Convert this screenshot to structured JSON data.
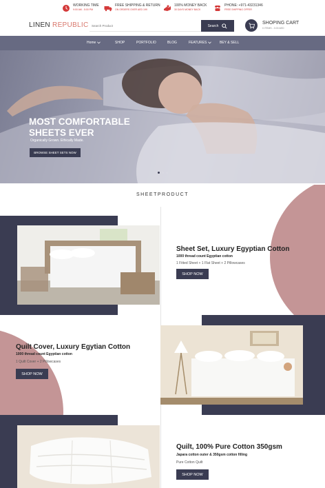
{
  "topbar": {
    "items": [
      {
        "title": "WORKING TIME",
        "sub": "9:00 AM - 5:00 PM",
        "icon": "clock-icon"
      },
      {
        "title": "FREE SHIPPING & RETURN",
        "sub": "ON ORDERS OVER AED 199",
        "icon": "truck-icon"
      },
      {
        "title": "100% MONEY BACK",
        "sub": "30 DAYS MONEY BACK",
        "icon": "money-back-icon"
      },
      {
        "title": "PHONE: +971-43231346",
        "sub": "FREE SHIPPING OFFER",
        "icon": "phone-icon"
      }
    ]
  },
  "header": {
    "logo_part1": "LINEN ",
    "logo_part2": "REPUBLIC",
    "search_placeholder": "Search Product",
    "search_label": "Search",
    "cart_title": "SHOPING CART",
    "cart_sub": "0 ITEMS - 0.00 AED"
  },
  "nav": {
    "items": [
      "Home",
      "SHOP",
      "PORTFOLIO",
      "BLOG",
      "FEATURES",
      "BEY & SELL"
    ]
  },
  "hero": {
    "title_line1": "MOST COMFORTABLE",
    "title_line2": "SHEETS EVER",
    "subtitle": "Organically Grown. Ethically Made.",
    "button": "BROWSE SHEET SETS NOW",
    "slides": 3,
    "active_slide": 1
  },
  "section": {
    "heading": "SHEETPRODUCT"
  },
  "products": [
    {
      "title": "Sheet Set, Luxury Egyptian Cotton",
      "sub": "1000 thread count Egyptian cotton",
      "contents": "1 Fitted Sheet + 1 Flat Sheet + 2 Pillowcases",
      "button": "SHOP NOW"
    },
    {
      "title": "Quilt Cover, Luxury Egytian Cotton",
      "sub": "1000 thread count Egyptian cotton",
      "contents": "1 Quilt Cover + 2 Pillowcases",
      "button": "SHOP NOW"
    },
    {
      "title": "Quilt, 100% Pure Cotton 350gsm",
      "sub": "Japara cotton outer & 350gsm cotton filling",
      "contents": "Pure Cotton Quilt",
      "button": "SHOP NOW"
    }
  ],
  "colors": {
    "navy": "#3a3c52",
    "nav_bg": "#676a82",
    "accent_rose": "#c49596",
    "logo_accent": "#d8776c",
    "topbar_icon": "#d43a3a"
  }
}
